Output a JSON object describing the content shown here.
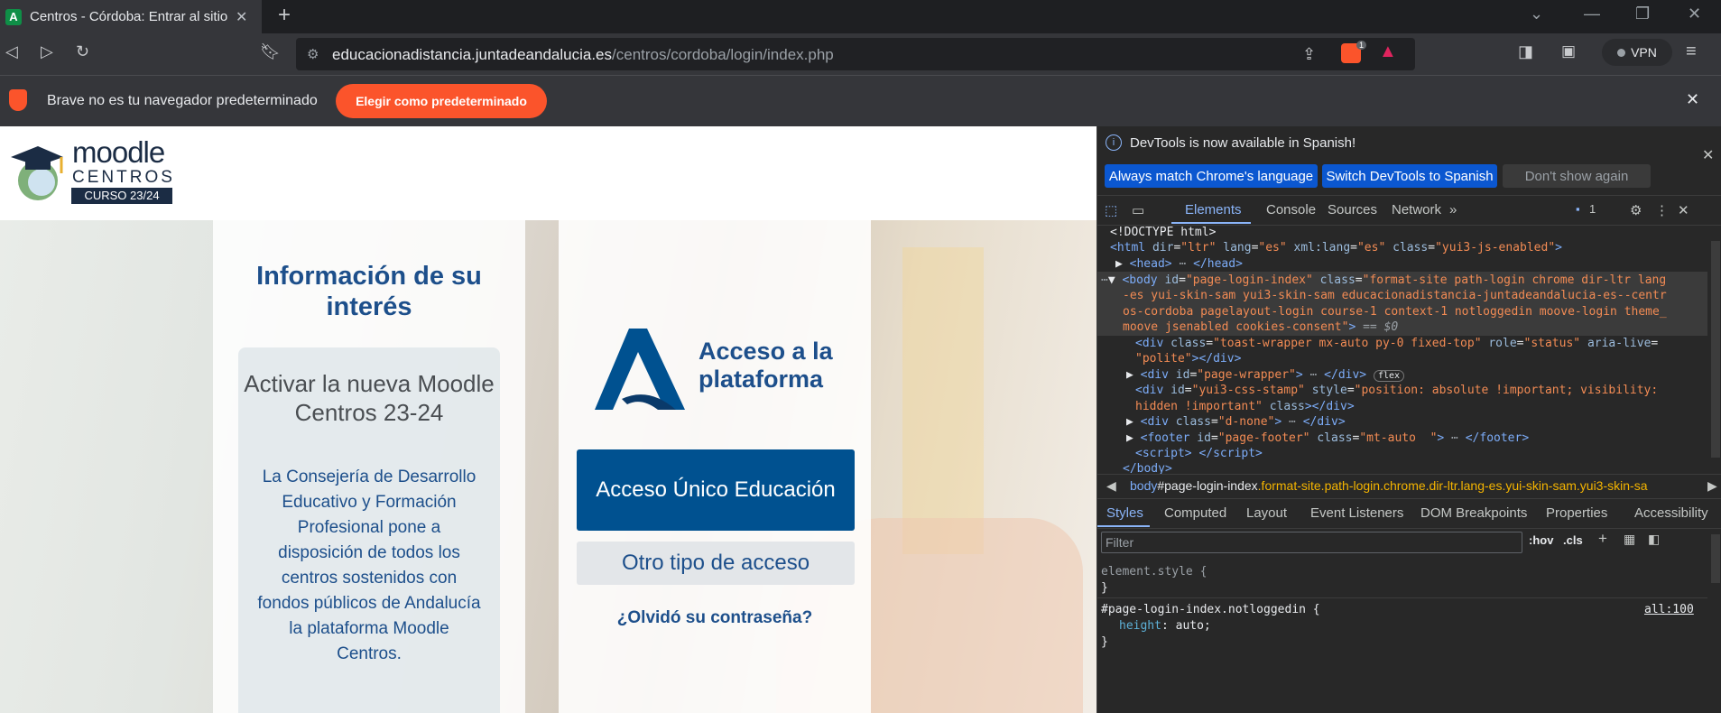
{
  "browser": {
    "tab_title": "Centros - Córdoba: Entrar al sitio",
    "url_host": "educacionadistancia.juntadeandalucia.es",
    "url_path": "/centros/cordoba/login/index.php",
    "vpn_label": "VPN",
    "shield_count": "1"
  },
  "infobar": {
    "message": "Brave no es tu navegador predeterminado",
    "button": "Elegir como predeterminado"
  },
  "page": {
    "logo_line1": "moodle",
    "logo_line2": "CENTROS",
    "logo_line3": "CURSO 23/24",
    "info_title": "Información de su interés",
    "card_title": "Activar la nueva Moodle Centros 23-24",
    "card_text": "La Consejería de Desarrollo Educativo y Formación Profesional pone a disposición de todos los centros sostenidos con fondos públicos de Andalucía la plataforma Moodle Centros.",
    "access_title_line1": "Acceso a la",
    "access_title_line2": "plataforma",
    "btn_unico": "Acceso Único Educación",
    "btn_otro": "Otro tipo de acceso",
    "forgot": "¿Olvidó su contraseña?"
  },
  "devtools": {
    "banner": "DevTools is now available in Spanish!",
    "btn_match": "Always match Chrome's language",
    "btn_switch": "Switch DevTools to Spanish",
    "btn_dont": "Don't show again",
    "tabs": [
      "Elements",
      "Console",
      "Sources",
      "Network"
    ],
    "issues_count": "1",
    "breadcrumb_tag": "body",
    "breadcrumb_id": "#page-login-index",
    "breadcrumb_classes": ".format-site.path-login.chrome.dir-ltr.lang-es.yui-skin-sam.yui3-skin-sa",
    "subtabs": [
      "Styles",
      "Computed",
      "Layout",
      "Event Listeners",
      "DOM Breakpoints",
      "Properties",
      "Accessibility"
    ],
    "filter_placeholder": "Filter",
    "hov": ":hov",
    "cls": ".cls",
    "styles_rule1": "element.style {",
    "styles_close": "}",
    "styles_rule2_selector": "#page-login-index.notloggedin {",
    "styles_rule2_source": "all:100",
    "styles_rule2_prop": "height",
    "styles_rule2_val": "auto;",
    "flex_badge": "flex",
    "dom_doctype": "<!DOCTYPE html>"
  }
}
